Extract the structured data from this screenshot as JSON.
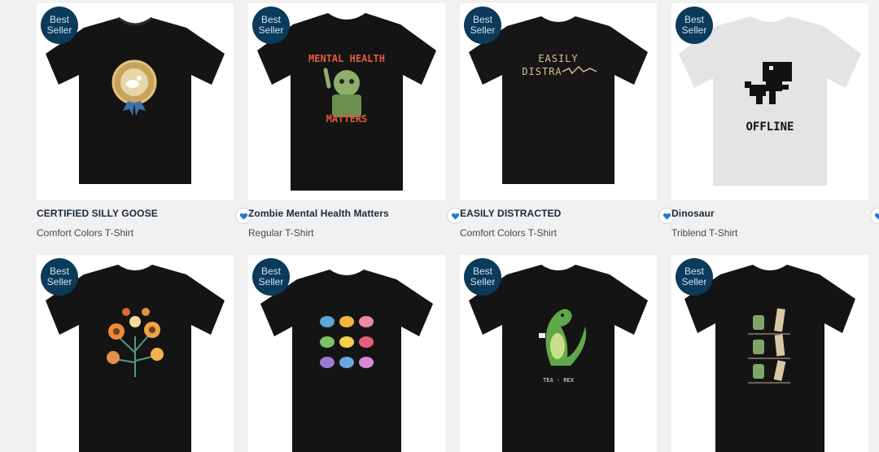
{
  "badge": {
    "line1": "Best",
    "line2": "Seller"
  },
  "icons": {
    "favorite": "heart-icon"
  },
  "colors": {
    "badge_bg": "#0b3a5a",
    "favorite": "#1f7bd6"
  },
  "products": [
    {
      "title": "CERTIFIED SILLY GOOSE",
      "type": "Comfort Colors T-Shirt",
      "best_seller": true
    },
    {
      "title": "Zombie Mental Health Matters",
      "type": "Regular T-Shirt",
      "best_seller": true,
      "print_top": "MENTAL HEALTH",
      "print_bottom": "MATTERS"
    },
    {
      "title": "EASILY DISTRACTED",
      "type": "Comfort Colors T-Shirt",
      "best_seller": true,
      "print_top": "EASILY",
      "print_bottom": "DISTRA"
    },
    {
      "title": "Dinosaur",
      "type": "Triblend T-Shirt",
      "best_seller": true,
      "print_text": "OFFLINE"
    },
    {
      "best_seller": true
    },
    {
      "best_seller": true
    },
    {
      "best_seller": true,
      "print_text": "TEA - REX"
    },
    {
      "best_seller": true
    }
  ]
}
